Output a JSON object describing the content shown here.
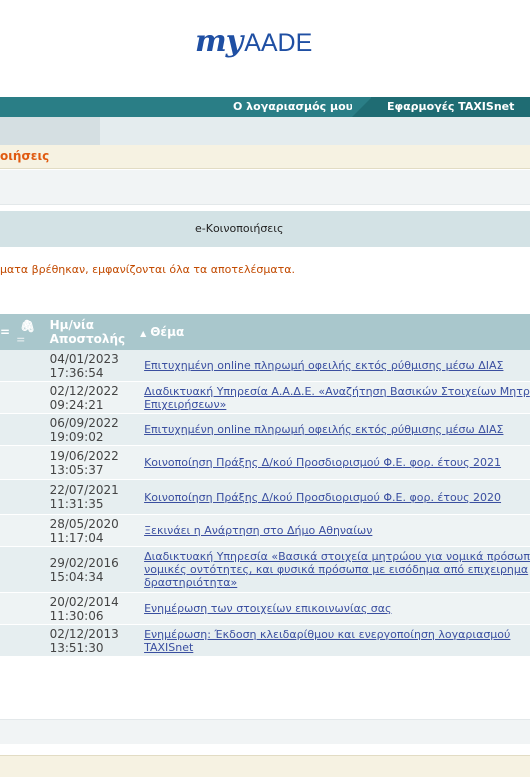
{
  "logo": {
    "my": "my",
    "brand": "AADE"
  },
  "tabs": {
    "account": "Ο λογαριασμός μου",
    "apps": "Εφαρμογές TAXISnet"
  },
  "breadcrumb": "οιήσεις",
  "section_title": "e-Κοινοποιήσεις",
  "notice": "ματα βρέθηκαν, εμφανίζονται όλα τα αποτελέσματα.",
  "table": {
    "col_mark": "=",
    "col_date": "Ημ/νία\nΑποστολής",
    "col_subject": "Θέμα",
    "rows": [
      {
        "date": "04/01/2023",
        "time": "17:36:54",
        "subject": [
          "Επιτυχημένη online πληρωμή οφειλής εκτός ρύθμισης μέσω ΔΙΑΣ"
        ]
      },
      {
        "date": "02/12/2022",
        "time": "09:24:21",
        "subject": [
          "Διαδικτυακή Υπηρεσία Α.Α.Δ.Ε. «Αναζήτηση Βασικών Στοιχείων Μητρ",
          "Επιχειρήσεων»"
        ]
      },
      {
        "date": "06/09/2022",
        "time": "19:09:02",
        "subject": [
          "Επιτυχημένη online πληρωμή οφειλής εκτός ρύθμισης μέσω ΔΙΑΣ"
        ]
      },
      {
        "date": "19/06/2022",
        "time": "13:05:37",
        "subject": [
          "Κοινοποίηση Πράξης Δ/κού Προσδιορισμού Φ.Ε. φορ. έτους 2021"
        ]
      },
      {
        "date": "22/07/2021",
        "time": "11:31:35",
        "subject": [
          "Κοινοποίηση Πράξης Δ/κού Προσδιορισμού Φ.Ε. φορ. έτους 2020"
        ]
      },
      {
        "date": "28/05/2020",
        "time": "11:17:04",
        "subject": [
          "Ξεκινάει η Ανάρτηση στο Δήμο Αθηναίων"
        ]
      },
      {
        "date": "29/02/2016",
        "time": "15:04:34",
        "subject": [
          "Διαδικτυακή Υπηρεσία «Βασικά στοιχεία μητρώου για νομικά πρόσωπ",
          "νομικές οντότητες, και φυσικά πρόσωπα με εισόδημα από επιχειρημα",
          "δραστηριότητα»"
        ]
      },
      {
        "date": "20/02/2014",
        "time": "11:30:06",
        "subject": [
          "Ενημέρωση των στοιχείων επικοινωνίας σας"
        ]
      },
      {
        "date": "02/12/2013",
        "time": "13:51:30",
        "subject": [
          "Ενημέρωση: Έκδοση κλειδαρίθμου και ενεργοποίηση λογαριασμού",
          "TAXISnet"
        ]
      }
    ]
  }
}
